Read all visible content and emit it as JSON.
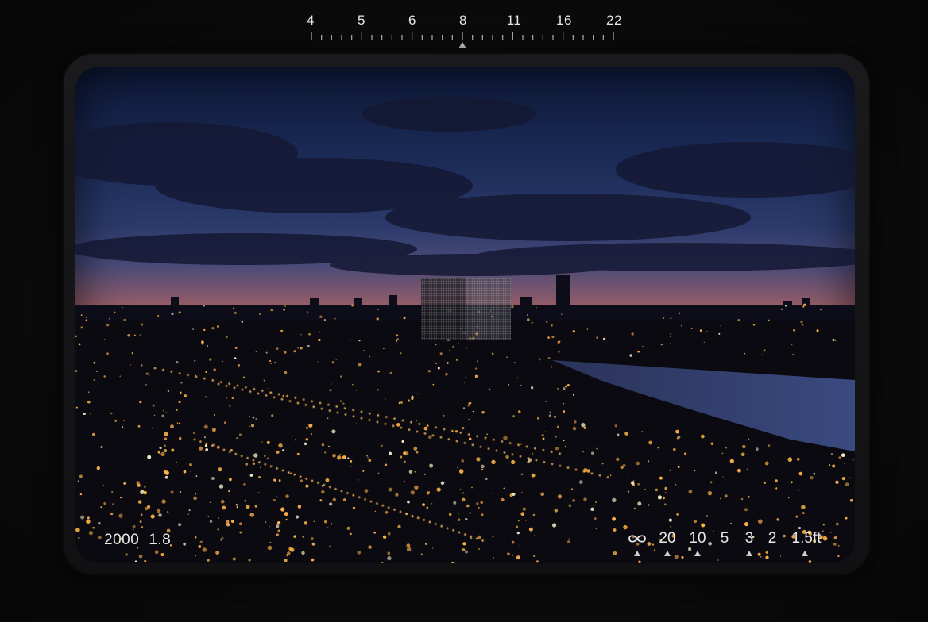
{
  "aperture_scale": {
    "labels": [
      "4",
      "5",
      "6",
      "8",
      "11",
      "16",
      "22"
    ],
    "selected": "8",
    "marker_icon": "triangle-up-icon"
  },
  "exposure": {
    "shutter": "2000",
    "fstop": "1.8"
  },
  "distance_scale": {
    "infinity_icon": "infinity-icon",
    "labels": [
      "20",
      "10",
      "5",
      "3",
      "2",
      "1.5ft"
    ],
    "marker_icon": "triangle-up-icon"
  },
  "focus_indicator": {
    "icon": "split-focus-square"
  },
  "colors": {
    "text": "#e8e8e8",
    "frame": "#111113",
    "city_light": "#ffb347",
    "sky_top": "#0f1a3a",
    "sunset": "#c46a4c"
  }
}
